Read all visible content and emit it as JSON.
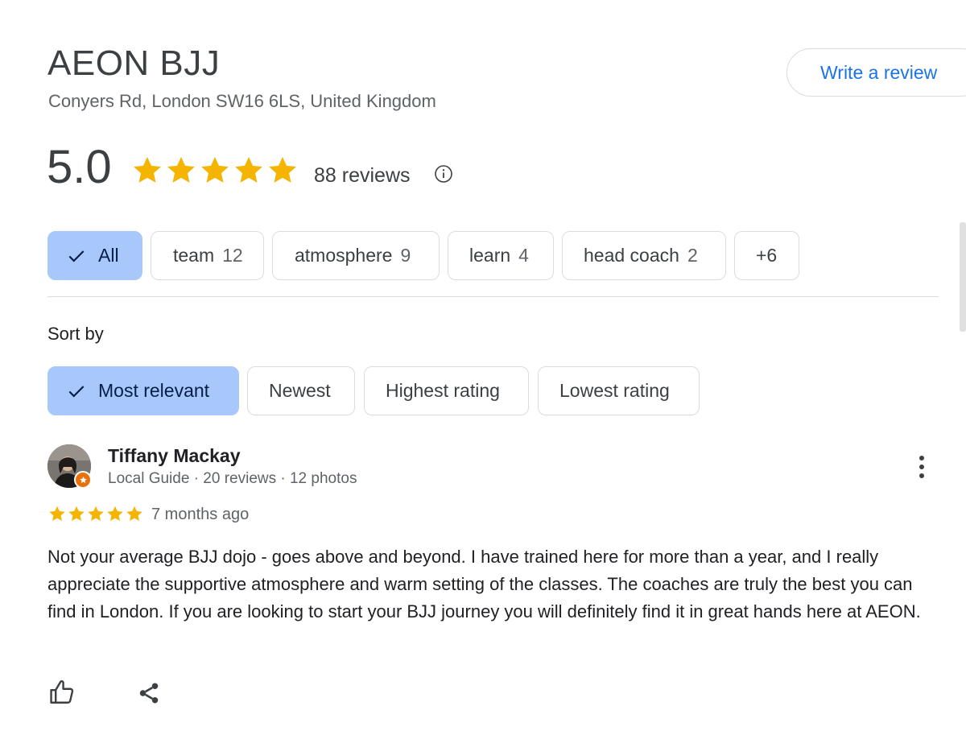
{
  "place": {
    "name": "AEON BJJ",
    "address": "Conyers Rd, London SW16 6LS, United Kingdom"
  },
  "actions": {
    "write_review_label": "Write a review"
  },
  "rating": {
    "value": "5.0",
    "stars": 5,
    "review_count_label": "88 reviews"
  },
  "topics": [
    {
      "label": "All",
      "count": "",
      "selected": true
    },
    {
      "label": "team",
      "count": "12",
      "selected": false
    },
    {
      "label": "atmosphere",
      "count": "9",
      "selected": false
    },
    {
      "label": "learn",
      "count": "4",
      "selected": false
    },
    {
      "label": "head coach",
      "count": "2",
      "selected": false
    },
    {
      "label": "+6",
      "count": "",
      "selected": false
    }
  ],
  "sort": {
    "label": "Sort by",
    "options": [
      {
        "label": "Most relevant",
        "selected": true
      },
      {
        "label": "Newest",
        "selected": false
      },
      {
        "label": "Highest rating",
        "selected": false
      },
      {
        "label": "Lowest rating",
        "selected": false
      }
    ]
  },
  "review": {
    "author": "Tiffany Mackay",
    "meta": "Local Guide · 20 reviews · 12 photos",
    "stars": 5,
    "time": "7 months ago",
    "text": "Not your average BJJ dojo - goes above and beyond. I have trained here for more than a year, and I really appreciate the supportive atmosphere and warm setting of the classes. The coaches are truly the best you can find in London. If you are looking to start your BJJ journey you will definitely find it in great hands here at AEON."
  },
  "icons": {
    "star": "star-icon",
    "info": "info-icon",
    "check": "check-icon",
    "more": "more-vert-icon",
    "like": "thumbs-up-icon",
    "share": "share-icon"
  },
  "colors": {
    "star": "#f4b400",
    "accent": "#1a73e8",
    "chip_selected_bg": "#a8c7fa",
    "guide_badge": "#e8710a"
  }
}
